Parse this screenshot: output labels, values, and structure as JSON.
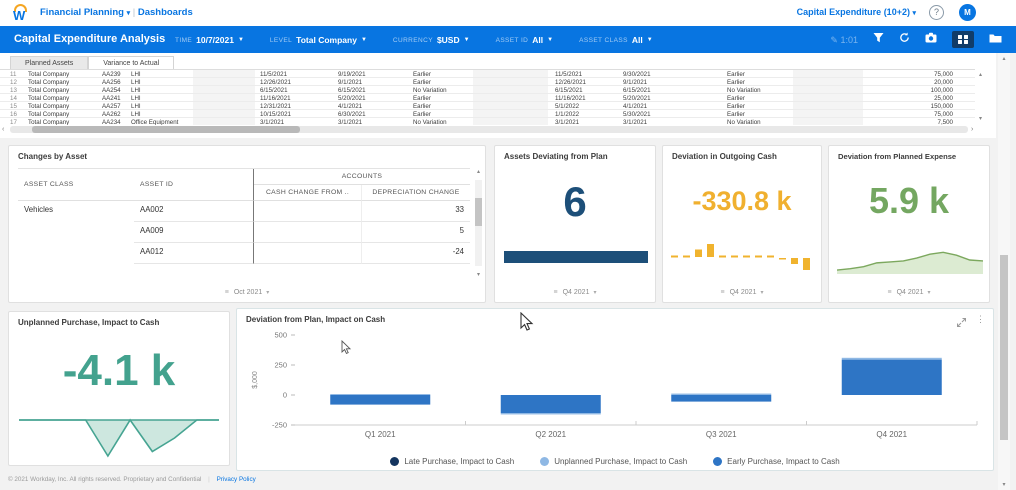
{
  "topbar": {
    "app_menu": "Financial Planning",
    "breadcrumb": "Dashboards",
    "workspace": "Capital Expenditure (10+2)",
    "help_glyph": "?",
    "avatar_initial": "M"
  },
  "header": {
    "title": "Capital Expenditure Analysis",
    "filters": [
      {
        "label": "TIME",
        "value": "10/7/2021"
      },
      {
        "label": "LEVEL",
        "value": "Total Company"
      },
      {
        "label": "CURRENCY",
        "value": "$USD"
      },
      {
        "label": "ASSET ID",
        "value": "All"
      },
      {
        "label": "ASSET CLASS",
        "value": "All"
      }
    ],
    "edit_label": "1:01"
  },
  "grid_table": {
    "tabs": [
      {
        "label": "Planned Assets",
        "active": true
      },
      {
        "label": "Variance to Actual",
        "active": false
      }
    ],
    "rows": [
      {
        "num": "11",
        "company": "Total Company",
        "asset_id": "AA239",
        "asset_class": "LHI",
        "plan_date": "11/5/2021",
        "actual_date": "9/19/2021",
        "variance": "Earlier",
        "plan_date2": "11/5/2021",
        "actual_date2": "9/30/2021",
        "variance2": "Earlier",
        "amount": "75,000"
      },
      {
        "num": "12",
        "company": "Total Company",
        "asset_id": "AA256",
        "asset_class": "LHI",
        "plan_date": "12/26/2021",
        "actual_date": "9/1/2021",
        "variance": "Earlier",
        "plan_date2": "12/26/2021",
        "actual_date2": "9/1/2021",
        "variance2": "Earlier",
        "amount": "20,000"
      },
      {
        "num": "13",
        "company": "Total Company",
        "asset_id": "AA254",
        "asset_class": "LHI",
        "plan_date": "6/15/2021",
        "actual_date": "6/15/2021",
        "variance": "No Variation",
        "plan_date2": "6/15/2021",
        "actual_date2": "6/15/2021",
        "variance2": "No Variation",
        "amount": "100,000"
      },
      {
        "num": "14",
        "company": "Total Company",
        "asset_id": "AA241",
        "asset_class": "LHI",
        "plan_date": "11/16/2021",
        "actual_date": "5/20/2021",
        "variance": "Earlier",
        "plan_date2": "11/16/2021",
        "actual_date2": "5/20/2021",
        "variance2": "Earlier",
        "amount": "25,000"
      },
      {
        "num": "15",
        "company": "Total Company",
        "asset_id": "AA257",
        "asset_class": "LHI",
        "plan_date": "12/31/2021",
        "actual_date": "4/1/2021",
        "variance": "Earlier",
        "plan_date2": "5/1/2022",
        "actual_date2": "4/1/2021",
        "variance2": "Earlier",
        "amount": "150,000"
      },
      {
        "num": "16",
        "company": "Total Company",
        "asset_id": "AA262",
        "asset_class": "LHI",
        "plan_date": "10/15/2021",
        "actual_date": "6/30/2021",
        "variance": "Earlier",
        "plan_date2": "1/1/2022",
        "actual_date2": "5/30/2021",
        "variance2": "Earlier",
        "amount": "75,000"
      },
      {
        "num": "17",
        "company": "Total Company",
        "asset_id": "AA234",
        "asset_class": "Office Equipment",
        "plan_date": "3/1/2021",
        "actual_date": "3/1/2021",
        "variance": "No Variation",
        "plan_date2": "3/1/2021",
        "actual_date2": "3/1/2021",
        "variance2": "No Variation",
        "amount": "7,500"
      }
    ]
  },
  "cards": {
    "changes": {
      "title": "Changes by Asset",
      "col_asset_class": "ASSET CLASS",
      "col_asset_id": "ASSET ID",
      "col_group_accounts": "ACCOUNTS",
      "col_cash_change": "CASH CHANGE FROM ..",
      "col_depreciation": "DEPRECIATION CHANGE",
      "rows": [
        {
          "asset_class": "Vehicles",
          "asset_id": "AA002",
          "cash_change": "",
          "depreciation": "33"
        },
        {
          "asset_class": "",
          "asset_id": "AA009",
          "cash_change": "",
          "depreciation": "5"
        },
        {
          "asset_class": "",
          "asset_id": "AA012",
          "cash_change": "",
          "depreciation": "-24"
        }
      ],
      "period": "Oct 2021"
    },
    "assets_deviating": {
      "title": "Assets Deviating from Plan",
      "value": "6",
      "period": "Q4 2021",
      "color": "#1d4f79"
    },
    "outgoing_cash": {
      "title": "Deviation in Outgoing Cash",
      "value": "-330.8 k",
      "period": "Q4 2021",
      "color": "#f0b02f"
    },
    "planned_expense": {
      "title": "Deviation from Planned Expense",
      "value": "5.9 k",
      "period": "Q4 2021",
      "color": "#74a761"
    },
    "unplanned_purchase": {
      "title": "Unplanned Purchase, Impact to Cash",
      "value": "-4.1 k",
      "color": "#43a28e"
    },
    "deviation_chart": {
      "title": "Deviation from Plan, Impact on Cash"
    }
  },
  "chart_data": [
    {
      "type": "bar",
      "title": "Deviation from Plan, Impact on Cash",
      "ylabel": "$,000",
      "categories": [
        "Q1 2021",
        "Q2 2021",
        "Q3 2021",
        "Q4 2021"
      ],
      "yticks": [
        500,
        250,
        0,
        -250
      ],
      "ylim": [
        -250,
        500
      ],
      "series": [
        {
          "name": "Late Purchase, Impact to Cash",
          "color": "#14355f",
          "values": [
            0,
            0,
            0,
            0
          ]
        },
        {
          "name": "Early Purchase, Impact to Cash",
          "color": "#2e75c5",
          "values": [
            -80,
            -150,
            -55,
            295
          ]
        },
        {
          "name": "Unplanned Purchase, Impact to Cash",
          "color": "#8fb8e4",
          "values": [
            8,
            -12,
            12,
            15
          ]
        }
      ],
      "legend_order": [
        "Late Purchase, Impact to Cash",
        "Unplanned Purchase, Impact to Cash",
        "Early Purchase, Impact to Cash"
      ],
      "legend_position": "bottom",
      "grid": false
    },
    {
      "type": "bar",
      "title": "Assets Deviating from Plan sparkline",
      "values": [
        6
      ],
      "color": "#1d4f79"
    },
    {
      "type": "bar",
      "title": "Deviation in Outgoing Cash sparkline",
      "values": [
        1,
        1,
        5,
        9,
        1,
        1,
        1,
        1,
        1,
        -1,
        -4,
        -8
      ],
      "color": "#f0b32e"
    },
    {
      "type": "area",
      "title": "Deviation from Planned Expense sparkline",
      "values": [
        0.4,
        0.7,
        1.1,
        1.9,
        2.1,
        2.3,
        2.9,
        3.7,
        4.1,
        3.5,
        2.5,
        2.3
      ],
      "color": "#7ca85e",
      "fill": "#dcebd2"
    },
    {
      "type": "area",
      "title": "Unplanned Purchase sparkline",
      "values": [
        0,
        0,
        0,
        0,
        -4,
        0,
        -3.5,
        -2,
        0,
        0
      ],
      "color": "#46a492",
      "fill": "#cde7df"
    }
  ],
  "footer": {
    "copyright": "© 2021 Workday, Inc. All rights reserved. Proprietary and Confidential",
    "privacy": "Privacy Policy"
  },
  "colors": {
    "brand_blue": "#0875e1",
    "navy": "#1d4f79",
    "amber": "#f0b02f",
    "green": "#74a761",
    "teal": "#43a28e"
  }
}
